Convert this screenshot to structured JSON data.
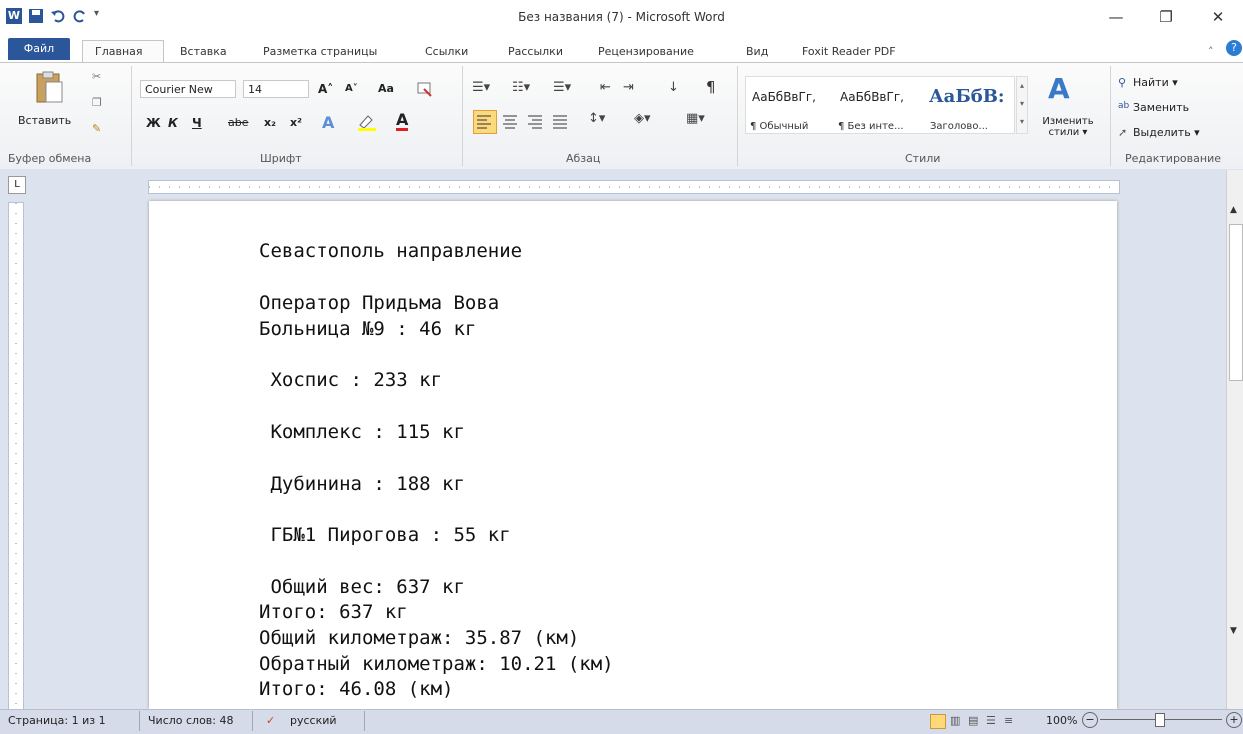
{
  "window": {
    "title": "Без названия (7)  -  Microsoft Word",
    "minimize": "—",
    "restore": "❐",
    "close": "✕"
  },
  "tabs": [
    "Файл",
    "Главная",
    "Вставка",
    "Разметка страницы",
    "Ссылки",
    "Рассылки",
    "Рецензирование",
    "Вид",
    "Foxit Reader PDF"
  ],
  "ribbon": {
    "paste_label": "Вставить",
    "font_name": "Courier New",
    "font_size": "14",
    "bold": "Ж",
    "italic": "К",
    "underline": "Ч",
    "strike": "abe",
    "sub": "x₂",
    "sup": "x²",
    "grow": "A˄",
    "shrink": "A˅",
    "case": "Aa",
    "styles": [
      {
        "sample": "АаБбВвГг,",
        "name": "¶ Обычный"
      },
      {
        "sample": "АаБбВвГг,",
        "name": "¶ Без инте..."
      },
      {
        "sample": "АаБбВ:",
        "name": "Заголово..."
      }
    ],
    "change_styles": "Изменить стили ▾",
    "find": "Найти ▾",
    "replace": "Заменить",
    "select": "Выделить ▾",
    "groups": [
      "Буфер обмена",
      "Шрифт",
      "Абзац",
      "Стили",
      "Редактирование"
    ]
  },
  "document": {
    "lines": [
      "Севастополь направление",
      "Оператор Придьма Вова",
      "Больница №9 : 46 кг",
      " Хоспис : 233 кг",
      " Комплекс : 115 кг",
      " Дубинина : 188 кг",
      " ГБ№1 Пирогова : 55 кг",
      " Общий вес: 637 кг",
      "Итого: 637 кг",
      "Общий километраж: 35.87 (км)",
      "Обратный километраж: 10.21 (км)",
      "Итого: 46.08 (км)"
    ]
  },
  "statusbar": {
    "page": "Страница: 1 из 1",
    "words": "Число слов: 48",
    "language": "русский",
    "zoom": "100%"
  }
}
